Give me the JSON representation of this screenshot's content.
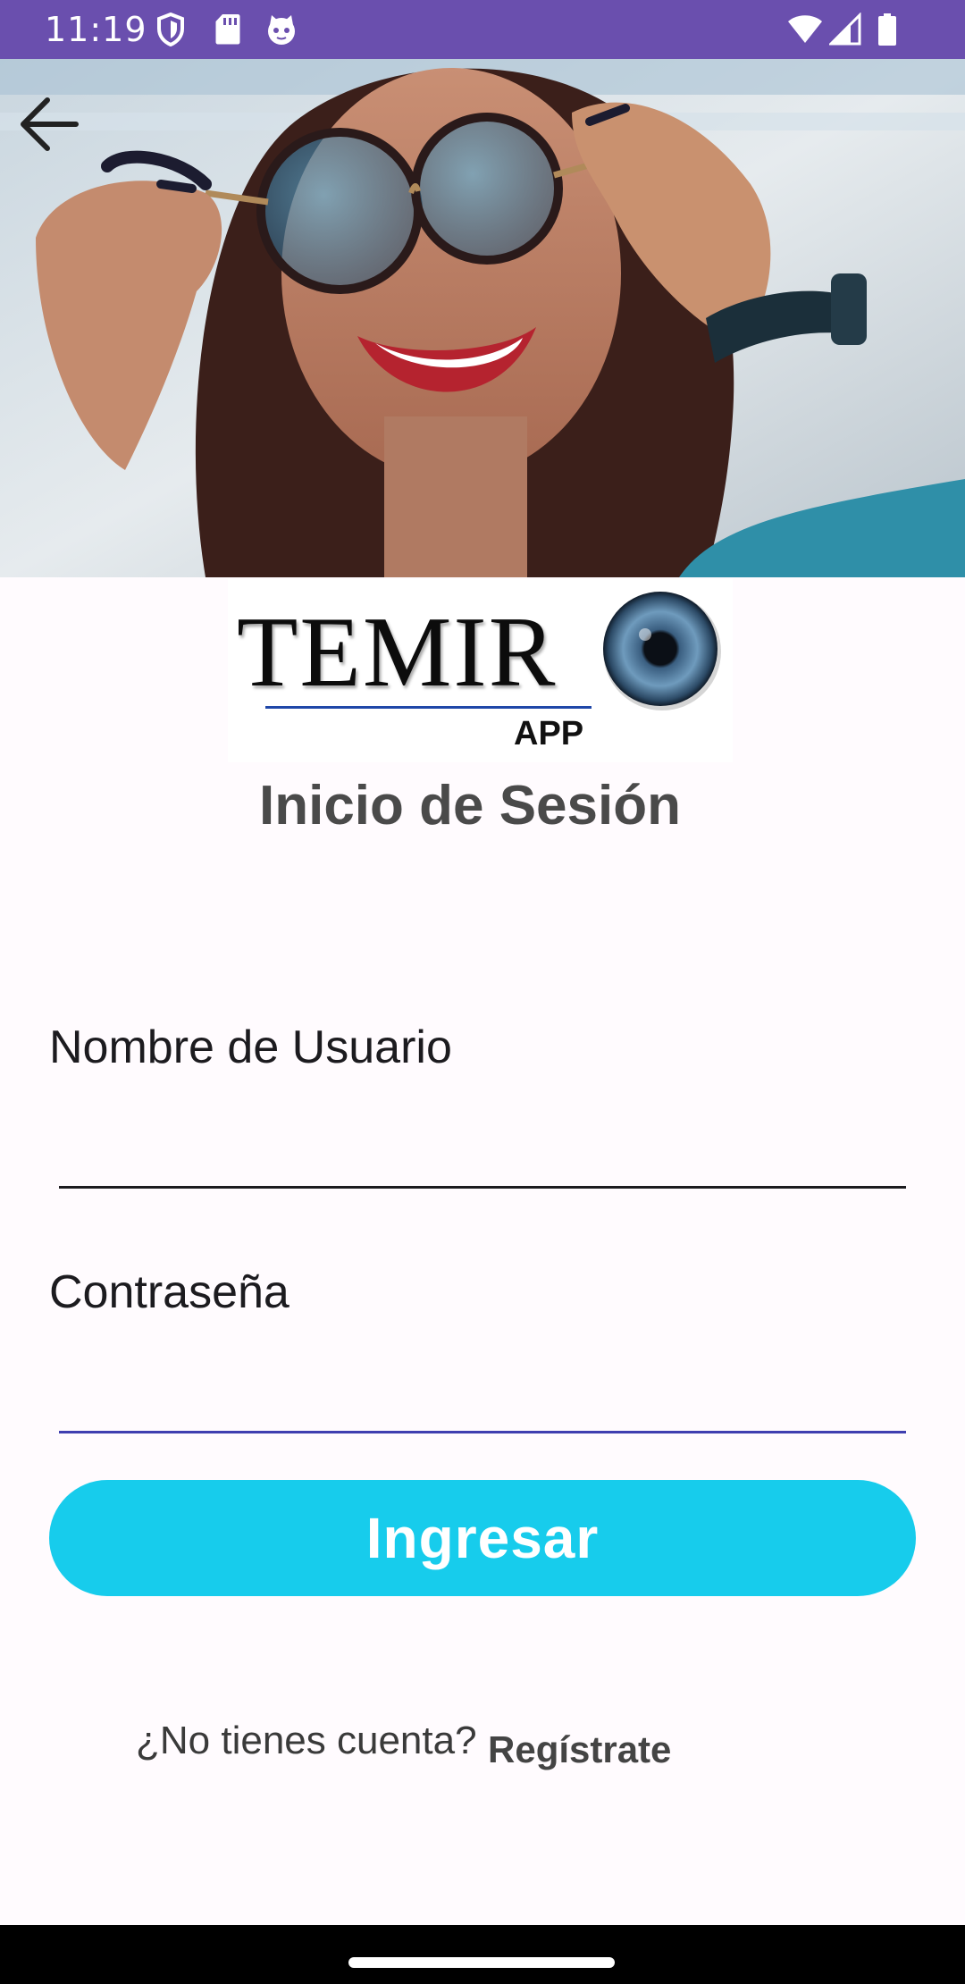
{
  "status_bar": {
    "time": "11:19",
    "background": "#6a4fae",
    "left_icons": [
      "shield-icon",
      "sd-card-icon",
      "cat-face-icon"
    ],
    "right_icons": [
      "wifi-icon",
      "cellular-signal-icon",
      "battery-icon"
    ]
  },
  "hero": {
    "image": "woman-adjusting-glasses-photo"
  },
  "toolbar": {
    "back_icon": "arrow-back-icon"
  },
  "logo": {
    "word": "TEMIR",
    "sub": "APP",
    "eye_icon": "eye-iris-icon"
  },
  "page": {
    "title": "Inicio de Sesión"
  },
  "form": {
    "username_label": "Nombre de Usuario",
    "username_value": "",
    "password_label": "Contraseña",
    "password_value": "",
    "underline_color": "#1c1b1f",
    "focused_underline_color": "#3f3fb0"
  },
  "actions": {
    "login_label": "Ingresar",
    "login_color": "#17ccec"
  },
  "register": {
    "prompt": "¿No tienes cuenta?",
    "link_label": "Regístrate"
  }
}
